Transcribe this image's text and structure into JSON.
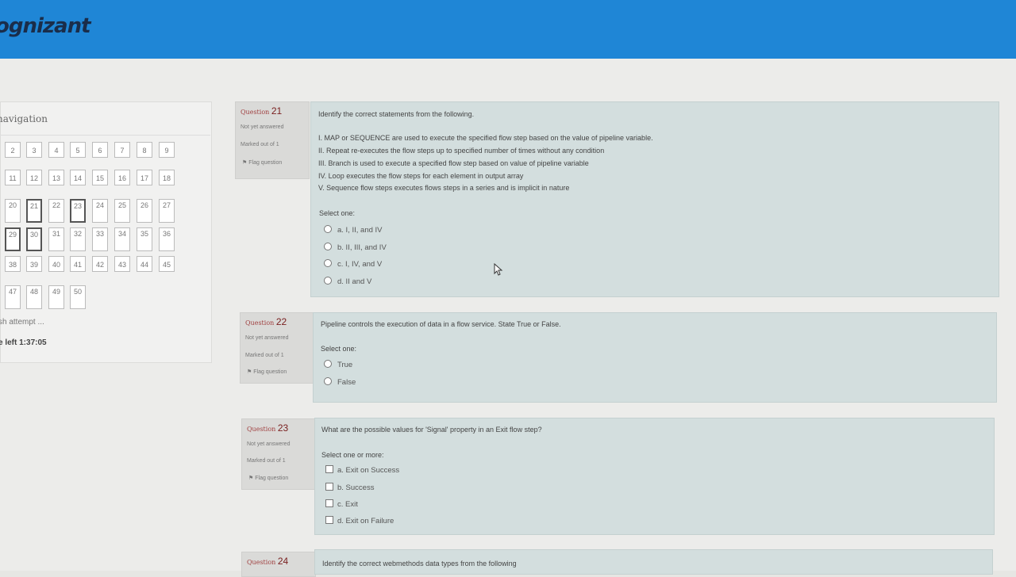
{
  "header": {
    "logo": "ognizant"
  },
  "nav": {
    "title": "navigation",
    "rows": [
      [
        "2",
        "3",
        "4",
        "5",
        "6",
        "7",
        "8",
        "9"
      ],
      [
        "11",
        "12",
        "13",
        "14",
        "15",
        "16",
        "17",
        "18"
      ],
      [
        "20",
        "21",
        "22",
        "23",
        "24",
        "25",
        "26",
        "27"
      ],
      [
        "29",
        "30",
        "31",
        "32",
        "33",
        "34",
        "35",
        "36"
      ],
      [
        "38",
        "39",
        "40",
        "41",
        "42",
        "43",
        "44",
        "45"
      ],
      [
        "47",
        "48",
        "49",
        "50"
      ]
    ],
    "finish": "sh attempt ...",
    "time_left": "e left 1:37:05"
  },
  "questions": [
    {
      "label": "Question",
      "number": "21",
      "status": "Not yet answered",
      "marks": "Marked out of 1",
      "flag": "Flag question",
      "text": "Identify the correct statements from the following.",
      "statements": [
        "I. MAP or SEQUENCE are used to execute the specified flow step based on the value of pipeline variable.",
        "II. Repeat re-executes the flow steps up to specified number of times without any condition",
        "III. Branch is used to execute a specified flow step based on value of pipeline variable",
        "IV. Loop executes the flow steps for each element in output array",
        "V. Sequence flow steps executes flows steps in a series and is implicit in nature"
      ],
      "select": "Select one:",
      "options": [
        "a. I, II, and IV",
        "b. II, III, and IV",
        "c. I, IV, and V",
        "d. II and V"
      ]
    },
    {
      "label": "Question",
      "number": "22",
      "status": "Not yet answered",
      "marks": "Marked out of 1",
      "flag": "Flag question",
      "text": "Pipeline controls the execution of data in a flow service. State True or False.",
      "select": "Select one:",
      "options": [
        "True",
        "False"
      ]
    },
    {
      "label": "Question",
      "number": "23",
      "status": "Not yet answered",
      "marks": "Marked out of 1",
      "flag": "Flag question",
      "text": "What are the possible values for 'Signal' property in an Exit flow step?",
      "select": "Select one or more:",
      "options": [
        "a. Exit on Success",
        "b. Success",
        "c. Exit",
        "d. Exit on Failure"
      ]
    },
    {
      "label": "Question",
      "number": "24",
      "text": "Identify the correct webmethods data types from the following"
    }
  ]
}
